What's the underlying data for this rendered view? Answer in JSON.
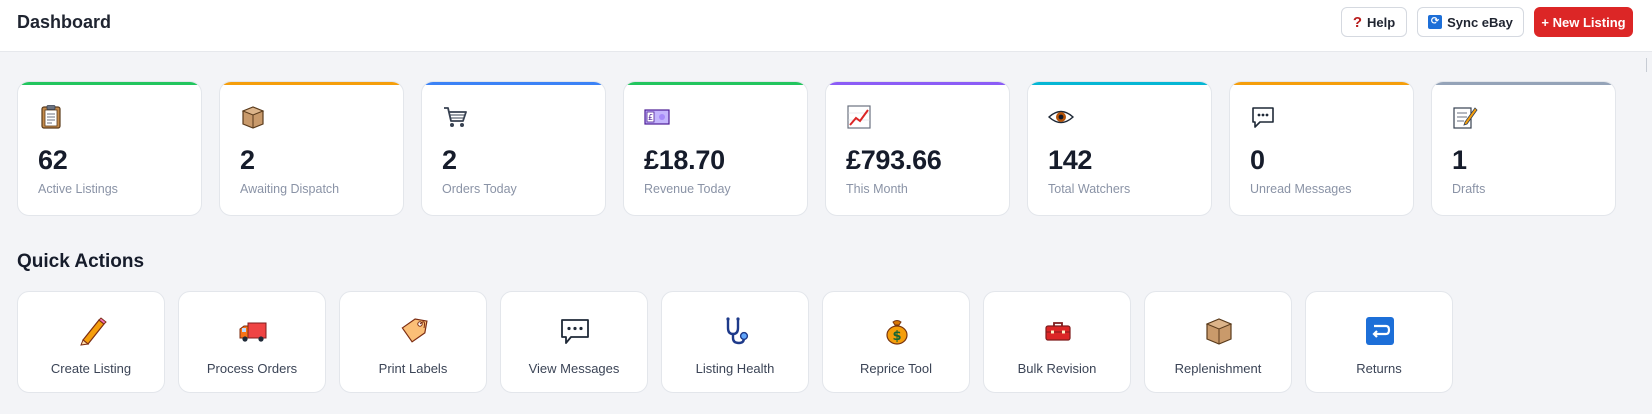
{
  "header": {
    "title": "Dashboard",
    "help_label": "Help",
    "sync_label": "Sync eBay",
    "new_listing_label": "+ New Listing"
  },
  "stats": [
    {
      "value": "62",
      "label": "Active Listings",
      "icon": "clipboard-icon",
      "accent": "#22c55e"
    },
    {
      "value": "2",
      "label": "Awaiting Dispatch",
      "icon": "package-icon",
      "accent": "#f59e0b"
    },
    {
      "value": "2",
      "label": "Orders Today",
      "icon": "shopping-cart-icon",
      "accent": "#3b82f6"
    },
    {
      "value": "£18.70",
      "label": "Revenue Today",
      "icon": "pound-note-icon",
      "accent": "#22c55e"
    },
    {
      "value": "£793.66",
      "label": "This Month",
      "icon": "chart-increasing-icon",
      "accent": "#8b5cf6"
    },
    {
      "value": "142",
      "label": "Total Watchers",
      "icon": "eye-icon",
      "accent": "#06b6d4"
    },
    {
      "value": "0",
      "label": "Unread Messages",
      "icon": "speech-bubble-icon",
      "accent": "#f59e0b"
    },
    {
      "value": "1",
      "label": "Drafts",
      "icon": "memo-icon",
      "accent": "#94a3b8"
    }
  ],
  "quick_actions": {
    "title": "Quick Actions",
    "items": [
      {
        "label": "Create Listing",
        "icon": "pencil-icon"
      },
      {
        "label": "Process Orders",
        "icon": "delivery-truck-icon"
      },
      {
        "label": "Print Labels",
        "icon": "label-tag-icon"
      },
      {
        "label": "View Messages",
        "icon": "speech-bubble-icon"
      },
      {
        "label": "Listing Health",
        "icon": "stethoscope-icon"
      },
      {
        "label": "Reprice Tool",
        "icon": "money-bag-icon"
      },
      {
        "label": "Bulk Revision",
        "icon": "toolbox-icon"
      },
      {
        "label": "Replenishment",
        "icon": "package-icon"
      },
      {
        "label": "Returns",
        "icon": "return-arrow-icon"
      }
    ]
  }
}
